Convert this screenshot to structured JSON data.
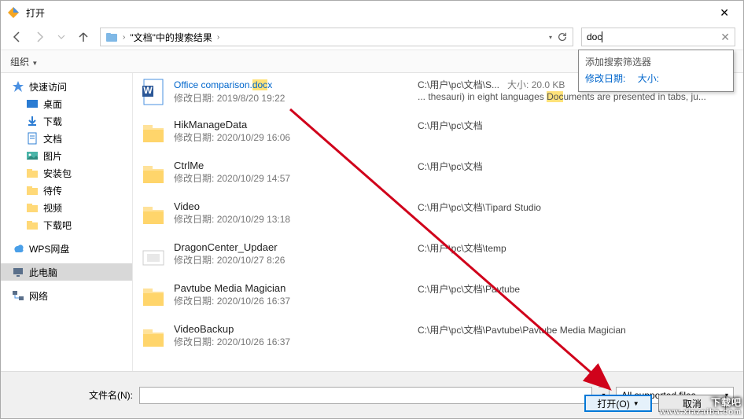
{
  "window": {
    "title": "打开"
  },
  "nav": {
    "breadcrumb": "\"文档\"中的搜索结果",
    "sep": "›"
  },
  "search": {
    "value": "doc",
    "suggest_title": "添加搜索筛选器",
    "suggest_date": "修改日期:",
    "suggest_size": "大小:"
  },
  "toolbar": {
    "organize": "组织"
  },
  "sidebar": {
    "quick": "快速访问",
    "desktop": "桌面",
    "downloads": "下载",
    "documents": "文档",
    "pictures": "图片",
    "pkg": "安装包",
    "pending": "待传",
    "video": "视频",
    "dlbar": "下载吧",
    "wps": "WPS网盘",
    "thispc": "此电脑",
    "network": "网络"
  },
  "dateLabel": "修改日期:",
  "sizeLabel": "大小:",
  "files": [
    {
      "name_pre": "Office comparison.",
      "name_hl": "doc",
      "name_post": "x",
      "date": "2019/8/20 19:22",
      "path": "C:\\用户\\pc\\文档\\S...",
      "size": "20.0 KB",
      "snip_pre": "... thesauri) in eight languages ",
      "snip_hl": "Doc",
      "snip_post": "uments are presented in tabs, ju..."
    },
    {
      "name": "HikManageData",
      "date": "2020/10/29 16:06",
      "path": "C:\\用户\\pc\\文档"
    },
    {
      "name": "CtrlMe",
      "date": "2020/10/29 14:57",
      "path": "C:\\用户\\pc\\文档"
    },
    {
      "name": "Video",
      "date": "2020/10/29 13:18",
      "path": "C:\\用户\\pc\\文档\\Tipard Studio"
    },
    {
      "name": "DragonCenter_Updaer",
      "date": "2020/10/27 8:26",
      "path": "C:\\用户\\pc\\文档\\temp"
    },
    {
      "name": "Pavtube Media Magician",
      "date": "2020/10/26 16:37",
      "path": "C:\\用户\\pc\\文档\\Pavtube"
    },
    {
      "name": "VideoBackup",
      "date": "2020/10/26 16:37",
      "path": "C:\\用户\\pc\\文档\\Pavtube\\Pavtube Media Magician"
    }
  ],
  "footer": {
    "filename_label": "文件名(N):",
    "filter": "All supported files",
    "open": "打开(O)",
    "cancel": "取消"
  },
  "watermark": {
    "big": "下载吧",
    "url": "www.xiazaiba.com"
  }
}
